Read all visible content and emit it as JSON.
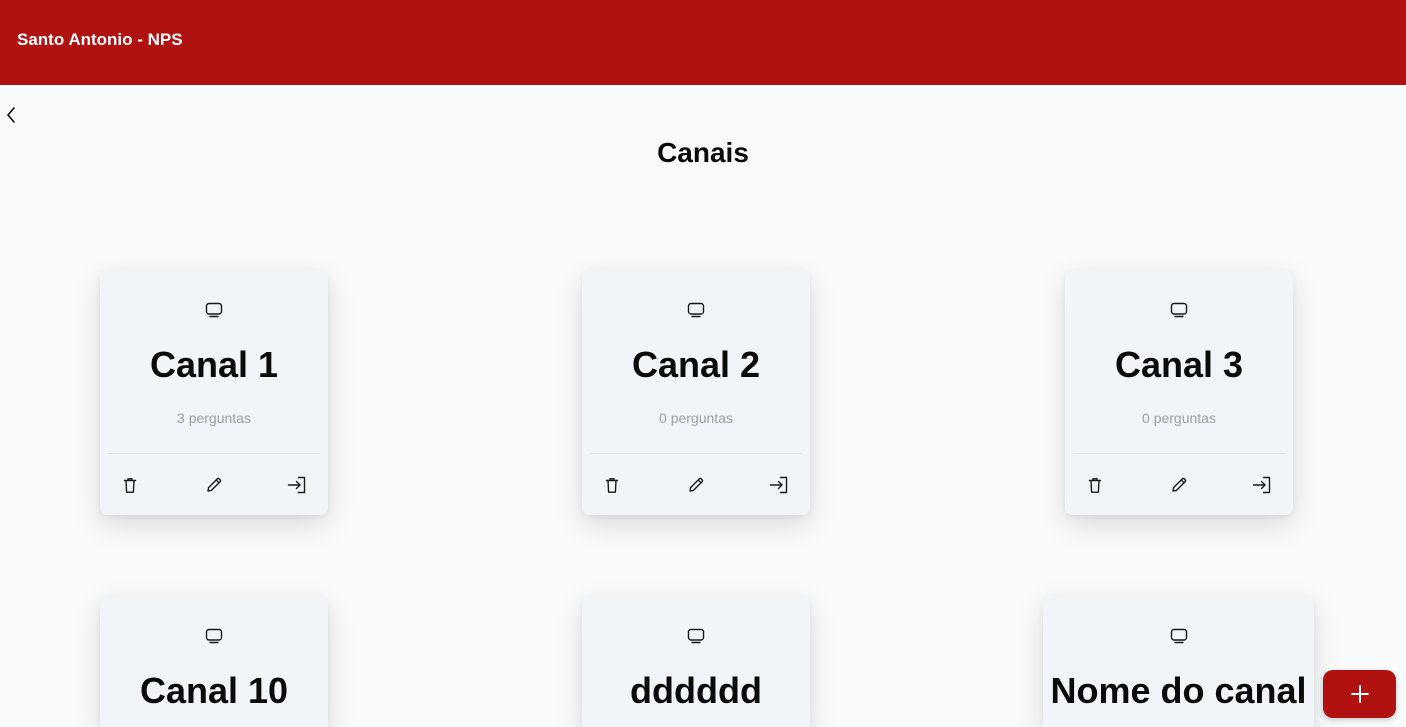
{
  "app": {
    "title": "Santo Antonio - NPS"
  },
  "page": {
    "title": "Canais"
  },
  "icons": {
    "back": "chevron-left-icon",
    "channel": "tv-icon",
    "delete": "trash-icon",
    "edit": "pencil-icon",
    "enter": "sign-in-icon",
    "add": "plus-icon"
  },
  "colors": {
    "brand": "#b01111",
    "background": "#f8fafc",
    "card": "#f1f4f8",
    "muted_text": "#9aa0a8"
  },
  "channels": [
    {
      "name": "Canal 1",
      "count": "3 perguntas"
    },
    {
      "name": "Canal 2",
      "count": "0 perguntas"
    },
    {
      "name": "Canal 3",
      "count": "0 perguntas"
    },
    {
      "name": "Canal 10"
    },
    {
      "name": "dddddd"
    },
    {
      "name": "Nome do canal"
    }
  ]
}
